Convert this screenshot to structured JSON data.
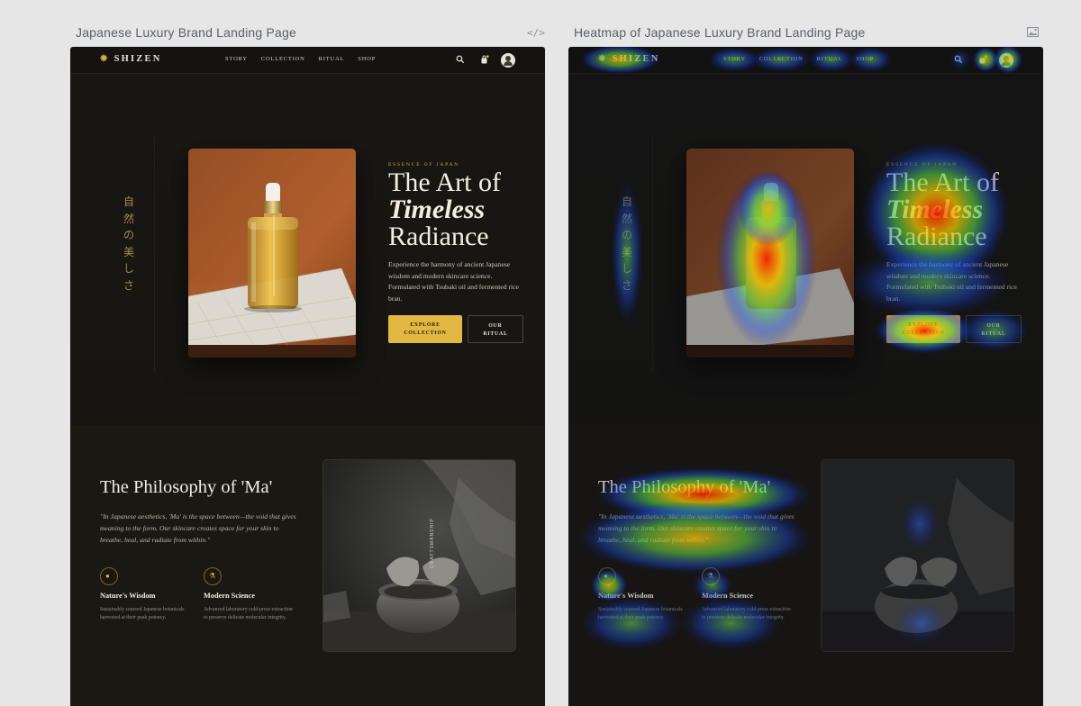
{
  "panels": {
    "left_title": "Japanese Luxury Brand Landing Page",
    "left_icon": "</>",
    "left_icon_name": "code-icon",
    "right_title": "Heatmap of Japanese Luxury Brand Landing Page",
    "right_icon_name": "image-icon"
  },
  "site": {
    "brand": "SHIZEN",
    "nav": [
      "STORY",
      "COLLECTION",
      "RITUAL",
      "SHOP"
    ],
    "vertical_text": "自然の美しさ",
    "hero": {
      "eyebrow": "ESSENCE OF JAPAN",
      "title_line1": "The Art of",
      "title_line2": "Timeless",
      "title_line3": "Radiance",
      "description": "Experience the harmony of ancient Japanese wisdom and modern skincare science. Formulated with Tsubaki oil and fermented rice bran.",
      "cta_primary_line1": "EXPLORE",
      "cta_primary_line2": "COLLECTION",
      "cta_secondary_line1": "OUR",
      "cta_secondary_line2": "RITUAL"
    },
    "philosophy": {
      "title": "The Philosophy of 'Ma'",
      "quote": "\"In Japanese aesthetics, 'Ma' is the space between—the void that gives meaning to the form. Our skincare creates space for your skin to breathe, heal, and radiate from within.\"",
      "features": [
        {
          "title": "Nature's Wisdom",
          "description": "Sustainably sourced Japanese botanicals harvested at their peak potency.",
          "icon": "leaf-icon"
        },
        {
          "title": "Modern Science",
          "description": "Advanced laboratory cold-press extraction to preserve delicate molecular integrity.",
          "icon": "flask-icon"
        }
      ]
    }
  },
  "colors": {
    "background": "#141311",
    "accent": "#e3b842",
    "text": "#f3eee3",
    "vertical_text": "#a38a48"
  }
}
